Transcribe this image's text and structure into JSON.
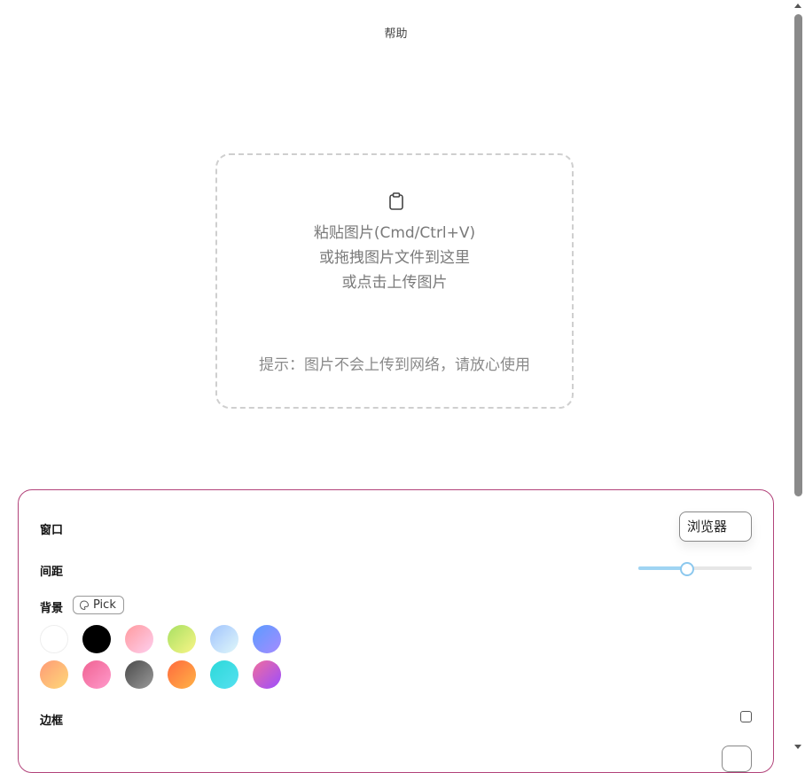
{
  "header": {
    "help_label": "帮助"
  },
  "dropzone": {
    "icon": "clipboard-icon",
    "line1": "粘贴图片(Cmd/Ctrl+V)",
    "line2": "或拖拽图片文件到这里",
    "line3": "或点击上传图片",
    "tip": "提示：图片不会上传到网络，请放心使用"
  },
  "settings": {
    "accent_color": "#b2437a",
    "window_label": "窗口",
    "window_value": "浏览器",
    "spacing_label": "间距",
    "spacing_fraction": 0.42,
    "background_label": "背景",
    "pick_label": "Pick",
    "pick_icon": "eyedropper-icon",
    "swatches": [
      "linear-gradient(135deg,#ffffff,#ffffff)",
      "linear-gradient(135deg,#000000,#000000)",
      "linear-gradient(135deg,#ff9a9e,#fecfef)",
      "linear-gradient(135deg,#a8e063,#f9f586)",
      "linear-gradient(135deg,#a1c4fd,#e0f7fa)",
      "linear-gradient(135deg,#5b9cff,#a58bff)",
      "linear-gradient(135deg,#ff9a76,#fdd979)",
      "linear-gradient(135deg,#f06292,#ff9acb)",
      "linear-gradient(135deg,#4a4a4a,#9a9a9a)",
      "linear-gradient(135deg,#ff6a3d,#ffb347)",
      "linear-gradient(135deg,#2bd9d9,#56e0f0)",
      "linear-gradient(135deg,#f06d9e,#9b4dff)"
    ],
    "border_label": "边框",
    "border_checked": false
  }
}
